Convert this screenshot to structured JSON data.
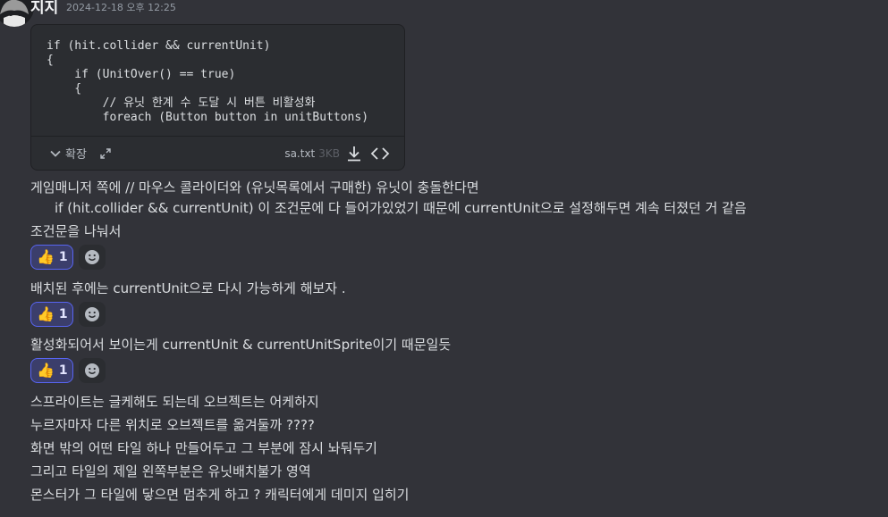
{
  "author": {
    "name": "지지",
    "timestamp": "2024-12-18 오후 12:25"
  },
  "attachment": {
    "code_lines": [
      "if (hit.collider && currentUnit)",
      "{",
      "    if (UnitOver() == true)",
      "    {",
      "        // 유닛 한계 수 도달 시 버튼 비활성화",
      "        foreach (Button button in unitButtons)"
    ],
    "expand_label": "확장",
    "filename": "sa.txt",
    "filesize": "3KB"
  },
  "messages": [
    "게임매니저 쪽에  // 마우스 콜라이더와 (유닛목록에서 구매한) 유닛이 충돌한다면",
    "if (hit.collider && currentUnit) 이 조건문에 다 들어가있었기 때문에 currentUnit으로 설정해두면 계속 터졌던 거 같음",
    "조건문을 나눠서",
    "배치된 후에는 currentUnit으로 다시 가능하게 해보자 .",
    "활성화되어서 보이는게 currentUnit & currentUnitSprite이기 때문일듯",
    "스프라이트는 글케해도 되는데 오브젝트는 어케하지",
    "누르자마자 다른 위치로 오브젝트를 옮겨둘까 ????",
    "화면 밖의 어떤 타일 하나 만들어두고 그 부분에 잠시 놔둬두기",
    "그리고 타일의 제일 왼쪽부분은 유닛배치불가 영역",
    "몬스터가 그 타일에 닿으면 멈추게 하고 ? 캐릭터에게 데미지 입히기"
  ],
  "reactions": [
    {
      "emoji": "👍",
      "count": "1"
    },
    {
      "emoji": "👍",
      "count": "1"
    },
    {
      "emoji": "👍",
      "count": "1"
    }
  ],
  "colors": {
    "background": "#323339",
    "reaction_bg": "#3b3e6b",
    "reaction_border": "#5865f2"
  }
}
